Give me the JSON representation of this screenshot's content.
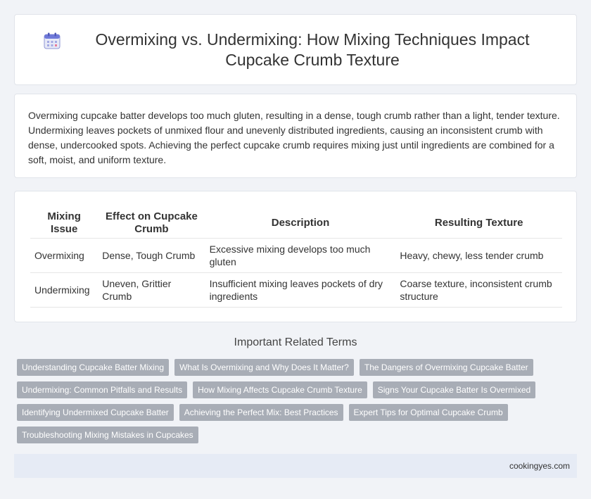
{
  "header": {
    "icon": "calendar-icon",
    "title": "Overmixing vs. Undermixing: How Mixing Techniques Impact Cupcake Crumb Texture"
  },
  "intro": "Overmixing cupcake batter develops too much gluten, resulting in a dense, tough crumb rather than a light, tender texture. Undermixing leaves pockets of unmixed flour and unevenly distributed ingredients, causing an inconsistent crumb with dense, undercooked spots. Achieving the perfect cupcake crumb requires mixing just until ingredients are combined for a soft, moist, and uniform texture.",
  "table": {
    "headers": [
      "Mixing Issue",
      "Effect on Cupcake Crumb",
      "Description",
      "Resulting Texture"
    ],
    "rows": [
      [
        "Overmixing",
        "Dense, Tough Crumb",
        "Excessive mixing develops too much gluten",
        "Heavy, chewy, less tender crumb"
      ],
      [
        "Undermixing",
        "Uneven, Grittier Crumb",
        "Insufficient mixing leaves pockets of dry ingredients",
        "Coarse texture, inconsistent crumb structure"
      ]
    ]
  },
  "related": {
    "title": "Important Related Terms",
    "tags": [
      "Understanding Cupcake Batter Mixing",
      "What Is Overmixing and Why Does It Matter?",
      "The Dangers of Overmixing Cupcake Batter",
      "Undermixing: Common Pitfalls and Results",
      "How Mixing Affects Cupcake Crumb Texture",
      "Signs Your Cupcake Batter Is Overmixed",
      "Identifying Undermixed Cupcake Batter",
      "Achieving the Perfect Mix: Best Practices",
      "Expert Tips for Optimal Cupcake Crumb",
      "Troubleshooting Mixing Mistakes in Cupcakes"
    ]
  },
  "footer": {
    "site": "cookingyes.com"
  }
}
